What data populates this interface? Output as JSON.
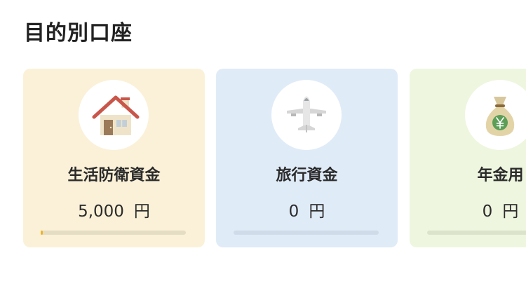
{
  "section": {
    "title": "目的別口座"
  },
  "accounts": [
    {
      "name": "生活防衛資金",
      "amount": "5,000",
      "unit": "円",
      "icon": "house-icon",
      "progress": 0.01,
      "bg_color": "#fbf1d8",
      "track_color": "#e5dcc4",
      "fill_color": "#f0b323"
    },
    {
      "name": "旅行資金",
      "amount": "0",
      "unit": "円",
      "icon": "airplane-icon",
      "progress": 0,
      "bg_color": "#e0ebf8",
      "track_color": "#cfdbe8",
      "fill_color": "#4a90d9"
    },
    {
      "name": "年金用",
      "amount": "0",
      "unit": "円",
      "icon": "money-bag-icon",
      "progress": 0,
      "bg_color": "#eef6df",
      "track_color": "#dbe3cb",
      "fill_color": "#8cc04a"
    }
  ]
}
